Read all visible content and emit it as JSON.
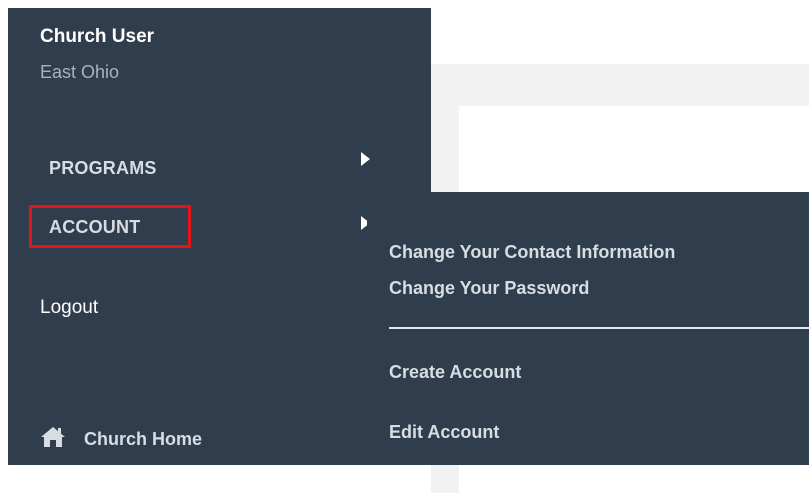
{
  "user": {
    "name": "Church User",
    "region": "East Ohio"
  },
  "nav": {
    "programs": "PROGRAMS",
    "account": "ACCOUNT",
    "logout": "Logout",
    "church_home": "Church Home",
    "church_home_icon": "home-icon",
    "arrow_icon": "caret-right-icon"
  },
  "account_menu": {
    "change_contact": "Change Your Contact Information",
    "change_password": "Change Your Password",
    "create_account": "Create Account",
    "edit_account": "Edit Account"
  },
  "colors": {
    "sidebar_bg": "#303d4c",
    "highlight_border": "#e5141b",
    "content_bg": "#f2f2f2"
  }
}
